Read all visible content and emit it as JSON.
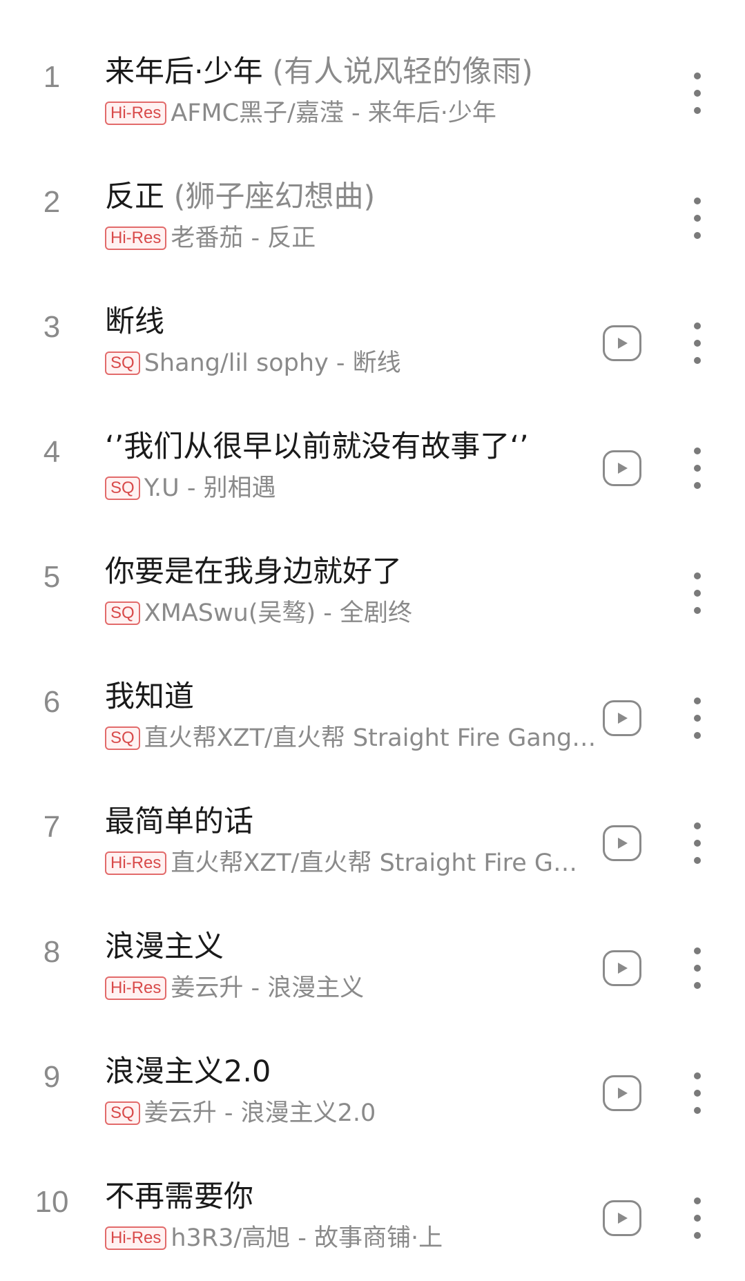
{
  "songs": [
    {
      "index": "1",
      "title": "来年后·少年",
      "note": " (有人说风轻的像雨)",
      "badge": "Hi-Res",
      "artist": "AFMC黑子/嘉滢 - 来年后·少年",
      "has_play": false
    },
    {
      "index": "2",
      "title": "反正",
      "note": " (狮子座幻想曲)",
      "badge": "Hi-Res",
      "artist": "老番茄 - 反正",
      "has_play": false
    },
    {
      "index": "3",
      "title": "断线",
      "note": "",
      "badge": "SQ",
      "artist": "Shang/lil sophy - 断线",
      "has_play": true
    },
    {
      "index": "4",
      "title": "‘’我们从很早以前就没有故事了‘’",
      "note": "",
      "badge": "SQ",
      "artist": "Y.U - 别相遇",
      "has_play": true
    },
    {
      "index": "5",
      "title": "你要是在我身边就好了",
      "note": "",
      "badge": "SQ",
      "artist": "XMASwu(吴骜) - 全剧终",
      "has_play": false
    },
    {
      "index": "6",
      "title": "我知道",
      "note": "",
      "badge": "SQ",
      "artist": "直火帮XZT/直火帮 Straight Fire Gang…",
      "has_play": true
    },
    {
      "index": "7",
      "title": "最简单的话",
      "note": "",
      "badge": "Hi-Res",
      "artist": "直火帮XZT/直火帮 Straight Fire G…",
      "has_play": true
    },
    {
      "index": "8",
      "title": "浪漫主义",
      "note": "",
      "badge": "Hi-Res",
      "artist": "姜云升 - 浪漫主义",
      "has_play": true
    },
    {
      "index": "9",
      "title": "浪漫主义2.0",
      "note": "",
      "badge": "SQ",
      "artist": "姜云升 - 浪漫主义2.0",
      "has_play": true
    },
    {
      "index": "10",
      "title": "不再需要你",
      "note": "",
      "badge": "Hi-Res",
      "artist": "h3R3/高旭 - 故事商铺·上",
      "has_play": true
    }
  ],
  "icons": {
    "play": "play-video-icon",
    "more": "more-vertical-icon"
  },
  "colors": {
    "badge_red": "#d84a4a",
    "secondary_text": "#8a8a8a",
    "primary_text": "#1a1a1a"
  }
}
